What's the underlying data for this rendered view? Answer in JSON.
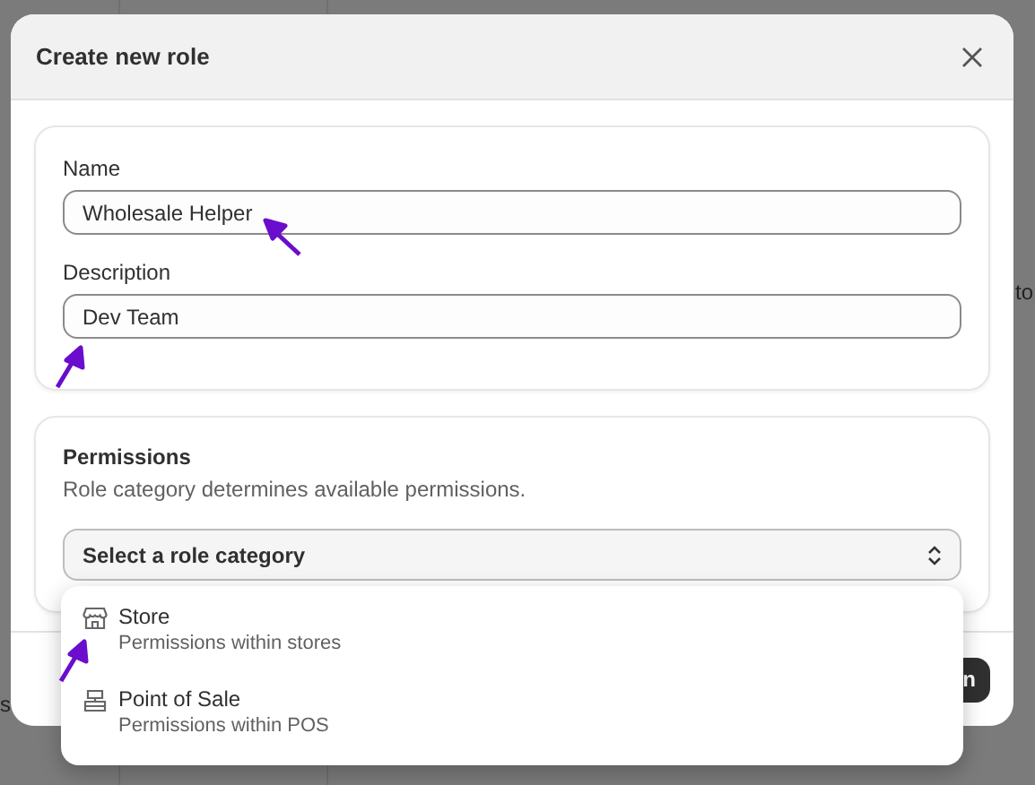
{
  "background": {
    "texts": [
      "to",
      "s"
    ]
  },
  "dialog": {
    "title": "Create new role"
  },
  "details": {
    "fields": [
      {
        "label": "Name",
        "value": "Wholesale Helper"
      },
      {
        "label": "Description",
        "value": "Dev Team"
      }
    ]
  },
  "permissions": {
    "title": "Permissions",
    "description": "Role category determines available permissions.",
    "select": {
      "placeholder": "Select a role category",
      "expanded": true
    }
  },
  "footer": {
    "button": "n"
  },
  "dropdown": {
    "options": [
      {
        "kind": "store",
        "label": "Store",
        "description": "Permissions within stores"
      },
      {
        "kind": "pos",
        "label": "Point of Sale",
        "description": "Permissions within POS"
      }
    ]
  }
}
